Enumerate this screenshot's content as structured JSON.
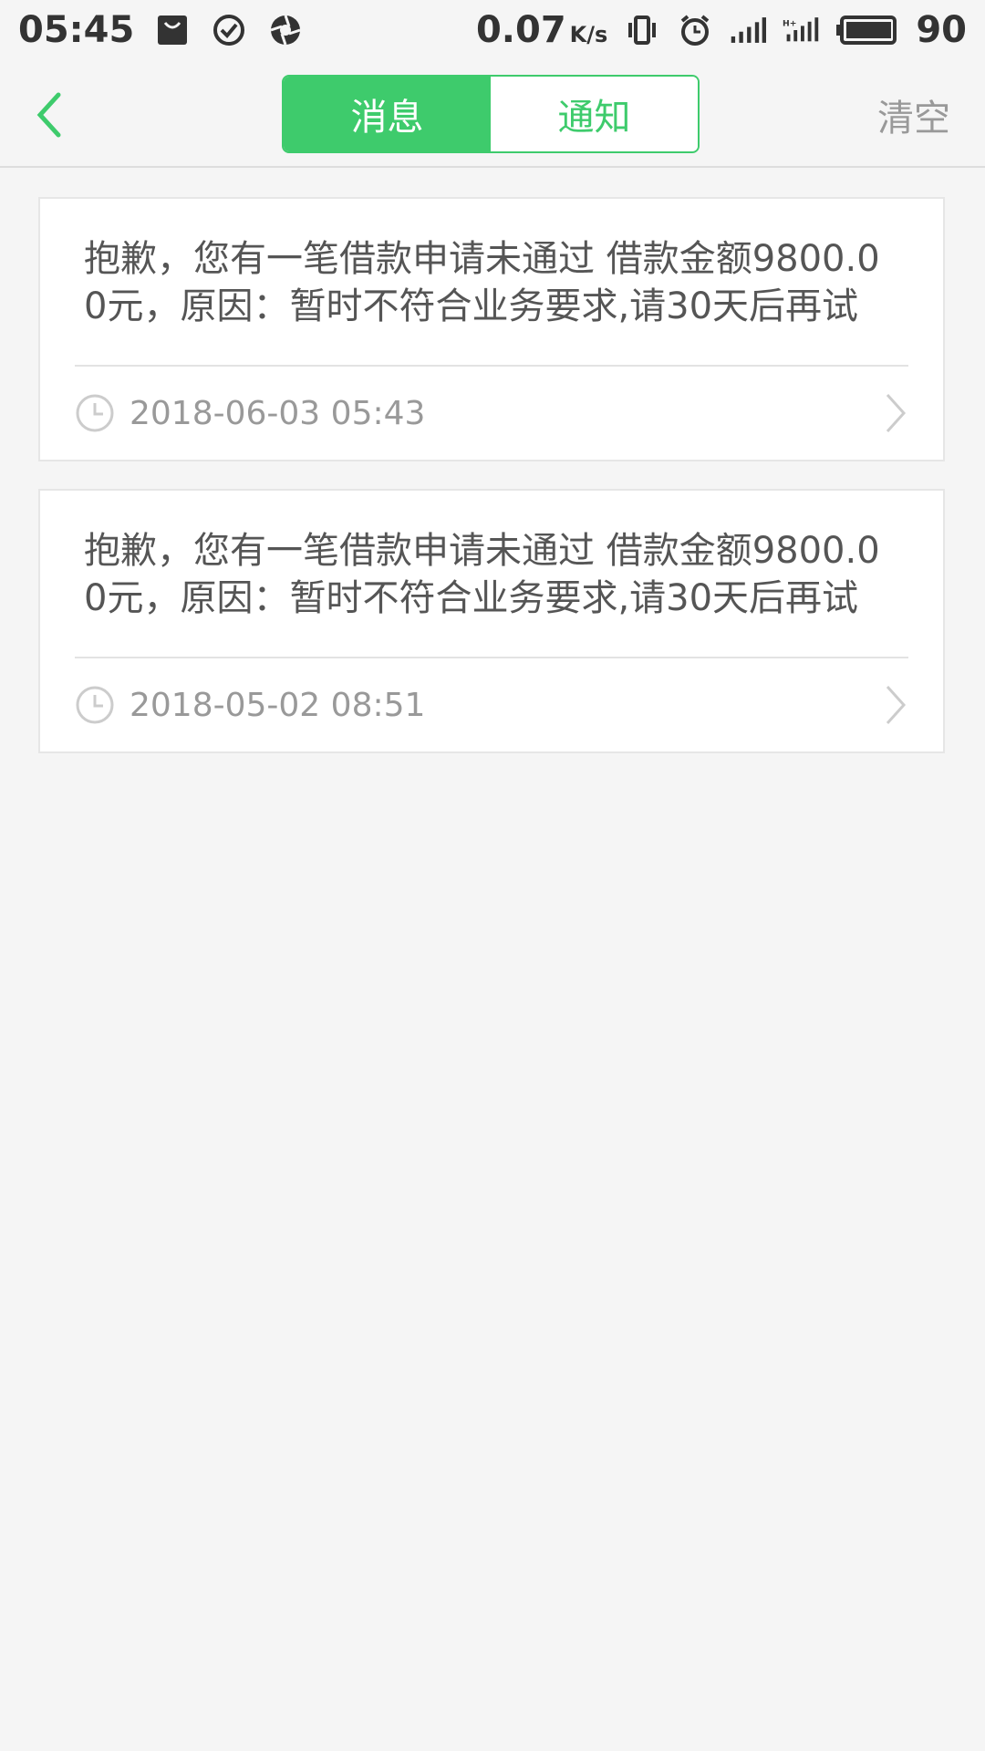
{
  "status_bar": {
    "time": "05:45",
    "speed": "0.07",
    "speed_unit": "K/s",
    "battery": "90",
    "icons": [
      "notification-bag-icon",
      "check-circle-icon",
      "aperture-icon",
      "vibrate-icon",
      "alarm-icon",
      "signal-icon",
      "signal-hplus-icon",
      "battery-icon"
    ]
  },
  "header": {
    "tabs": [
      {
        "label": "消息",
        "active": true
      },
      {
        "label": "通知",
        "active": false
      }
    ],
    "clear_label": "清空",
    "accent_color": "#3ecb6c"
  },
  "messages": [
    {
      "text": "抱歉，您有一笔借款申请未通过 借款金额9800.00元，原因：暂时不符合业务要求,请30天后再试",
      "time": "2018-06-03 05:43"
    },
    {
      "text": "抱歉，您有一笔借款申请未通过 借款金额9800.00元，原因：暂时不符合业务要求,请30天后再试",
      "time": "2018-05-02 08:51"
    }
  ]
}
